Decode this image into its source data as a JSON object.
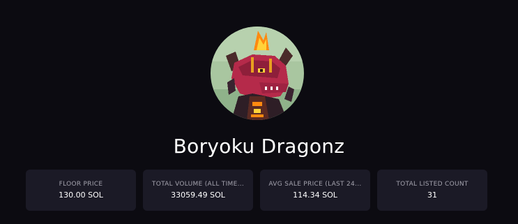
{
  "collection": {
    "name": "Boryoku Dragonz",
    "avatar_icon": "dragon-avatar-image"
  },
  "stats": [
    {
      "label": "FLOOR PRICE",
      "value": "130.00 SOL"
    },
    {
      "label": "TOTAL VOLUME (ALL TIME...",
      "value": "33059.49 SOL"
    },
    {
      "label": "AVG SALE PRICE (LAST 24...",
      "value": "114.34 SOL"
    },
    {
      "label": "TOTAL LISTED COUNT",
      "value": "31"
    }
  ],
  "colors": {
    "background": "#0c0b11",
    "card": "#1b1a26",
    "label": "#a3a2ad",
    "text": "#ffffff"
  }
}
